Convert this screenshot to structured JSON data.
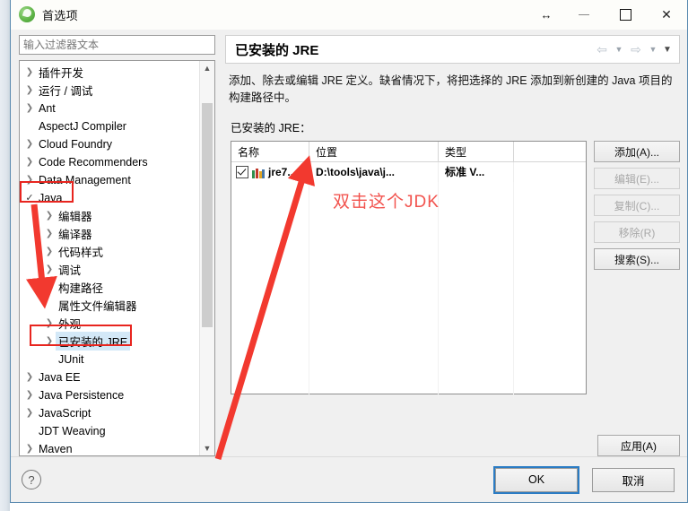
{
  "window": {
    "title": "首选项",
    "app_icon": "eclipse-circle-icon",
    "controls": {
      "resize": "resize-horizontal-icon",
      "minimize": "minimize-icon",
      "maximize": "maximize-icon",
      "close": "close-icon"
    }
  },
  "sidebar": {
    "filter_placeholder": "输入过滤器文本",
    "filter_value": "",
    "items": [
      {
        "label": "插件开发",
        "level": 1,
        "expandable": true,
        "selected": false,
        "checked": false
      },
      {
        "label": "运行 / 调试",
        "level": 1,
        "expandable": true,
        "selected": false,
        "checked": false
      },
      {
        "label": "Ant",
        "level": 1,
        "expandable": true,
        "selected": false,
        "checked": false
      },
      {
        "label": "AspectJ Compiler",
        "level": 1,
        "expandable": false,
        "selected": false,
        "checked": false
      },
      {
        "label": "Cloud Foundry",
        "level": 1,
        "expandable": true,
        "selected": false,
        "checked": false
      },
      {
        "label": "Code Recommenders",
        "level": 1,
        "expandable": true,
        "selected": false,
        "checked": false
      },
      {
        "label": "Data Management",
        "level": 1,
        "expandable": true,
        "selected": false,
        "checked": false
      },
      {
        "label": "Java",
        "level": 1,
        "expandable": false,
        "selected": false,
        "checked": true
      },
      {
        "label": "编辑器",
        "level": 2,
        "expandable": true,
        "selected": false,
        "checked": false
      },
      {
        "label": "编译器",
        "level": 2,
        "expandable": true,
        "selected": false,
        "checked": false
      },
      {
        "label": "代码样式",
        "level": 2,
        "expandable": true,
        "selected": false,
        "checked": false
      },
      {
        "label": "调试",
        "level": 2,
        "expandable": true,
        "selected": false,
        "checked": false
      },
      {
        "label": "构建路径",
        "level": 2,
        "expandable": true,
        "selected": false,
        "checked": false
      },
      {
        "label": "属性文件编辑器",
        "level": 2,
        "expandable": false,
        "selected": false,
        "checked": false
      },
      {
        "label": "外观",
        "level": 2,
        "expandable": true,
        "selected": false,
        "checked": false
      },
      {
        "label": "已安装的 JRE",
        "level": 2,
        "expandable": true,
        "selected": true,
        "checked": false
      },
      {
        "label": "JUnit",
        "level": 2,
        "expandable": false,
        "selected": false,
        "checked": false
      },
      {
        "label": "Java EE",
        "level": 1,
        "expandable": true,
        "selected": false,
        "checked": false
      },
      {
        "label": "Java Persistence",
        "level": 1,
        "expandable": true,
        "selected": false,
        "checked": false
      },
      {
        "label": "JavaScript",
        "level": 1,
        "expandable": true,
        "selected": false,
        "checked": false
      },
      {
        "label": "JDT Weaving",
        "level": 1,
        "expandable": false,
        "selected": false,
        "checked": false
      },
      {
        "label": "Maven",
        "level": 1,
        "expandable": true,
        "selected": false,
        "checked": false
      }
    ],
    "scrollbar": {
      "up_icon": "chevron-up-icon",
      "down_icon": "chevron-down-icon"
    }
  },
  "page": {
    "title": "已安装的 JRE",
    "description": "添加、除去或编辑 JRE 定义。缺省情况下，将把选择的 JRE 添加到新创建的 Java 项目的构建路径中。",
    "table_label": "已安装的 JRE：",
    "nav": {
      "back_icon": "arrow-left-icon",
      "back_caret_icon": "chevron-down-icon",
      "forward_icon": "arrow-right-icon",
      "forward_caret_icon": "chevron-down-icon",
      "menu_caret_icon": "chevron-down-icon"
    }
  },
  "table": {
    "columns": [
      "名称",
      "位置",
      "类型",
      ""
    ],
    "rows": [
      {
        "checked": true,
        "icon": "jre-library-icon",
        "name": "jre7...",
        "location": "D:\\tools\\java\\j...",
        "type": "标准 V...",
        "extra": ""
      }
    ]
  },
  "side_buttons": [
    {
      "label": "添加(A)...",
      "mnemonic": "A",
      "enabled": true
    },
    {
      "label": "编辑(E)...",
      "mnemonic": "E",
      "enabled": false
    },
    {
      "label": "复制(C)...",
      "mnemonic": "C",
      "enabled": false
    },
    {
      "label": "移除(R)",
      "mnemonic": "R",
      "enabled": false
    },
    {
      "label": "搜索(S)...",
      "mnemonic": "S",
      "enabled": true
    }
  ],
  "apply_button": {
    "label": "应用(A)",
    "mnemonic": "A"
  },
  "footer": {
    "help_icon": "question-mark-icon",
    "ok_label": "OK",
    "cancel_label": "取消"
  },
  "annotation": {
    "text": "双击这个JDK",
    "color": "#f2534e",
    "box_color": "#e8251f",
    "boxes": [
      "java-tree-item",
      "installed-jre-tree-item"
    ],
    "arrows": [
      "java-to-properties-editor-arrow",
      "bottom-left-to-jre-row-arrow"
    ]
  }
}
